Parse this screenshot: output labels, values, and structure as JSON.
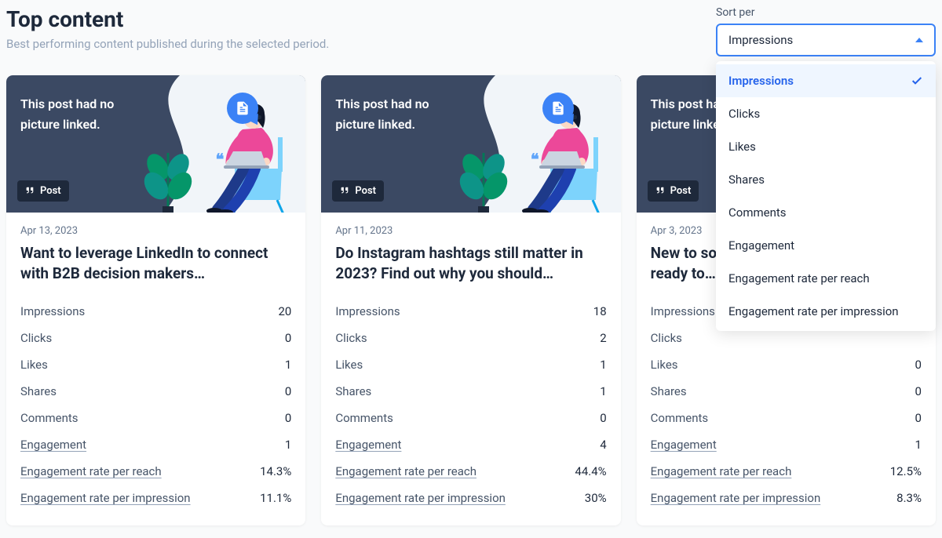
{
  "header": {
    "title": "Top content",
    "subtitle": "Best performing content published during the selected period."
  },
  "sort": {
    "label": "Sort per",
    "selected": "Impressions",
    "options": [
      "Impressions",
      "Clicks",
      "Likes",
      "Shares",
      "Comments",
      "Engagement",
      "Engagement rate per reach",
      "Engagement rate per impression"
    ]
  },
  "hero_text_line1": "This post had no",
  "hero_text_line2": "picture linked.",
  "post_badge_label": "Post",
  "metric_labels": {
    "impressions": "Impressions",
    "clicks": "Clicks",
    "likes": "Likes",
    "shares": "Shares",
    "comments": "Comments",
    "engagement": "Engagement",
    "err": "Engagement rate per reach",
    "eri": "Engagement rate per impression"
  },
  "cards": [
    {
      "date": "Apr 13, 2023",
      "title": "Want to leverage LinkedIn to connect with B2B decision makers…",
      "impressions": "20",
      "clicks": "0",
      "likes": "1",
      "shares": "0",
      "comments": "0",
      "engagement": "1",
      "err": "14.3%",
      "eri": "11.1%"
    },
    {
      "date": "Apr 11, 2023",
      "title": "Do Instagram hashtags still matter in 2023? Find out why you should…",
      "impressions": "18",
      "clicks": "2",
      "likes": "1",
      "shares": "1",
      "comments": "0",
      "engagement": "4",
      "err": "44.4%",
      "eri": "30%"
    },
    {
      "date": "Apr 3, 2023",
      "title": "New to social media marketing and ready to…",
      "impressions": "",
      "clicks": "",
      "likes": "0",
      "shares": "0",
      "comments": "0",
      "engagement": "1",
      "err": "12.5%",
      "eri": "8.3%"
    }
  ]
}
